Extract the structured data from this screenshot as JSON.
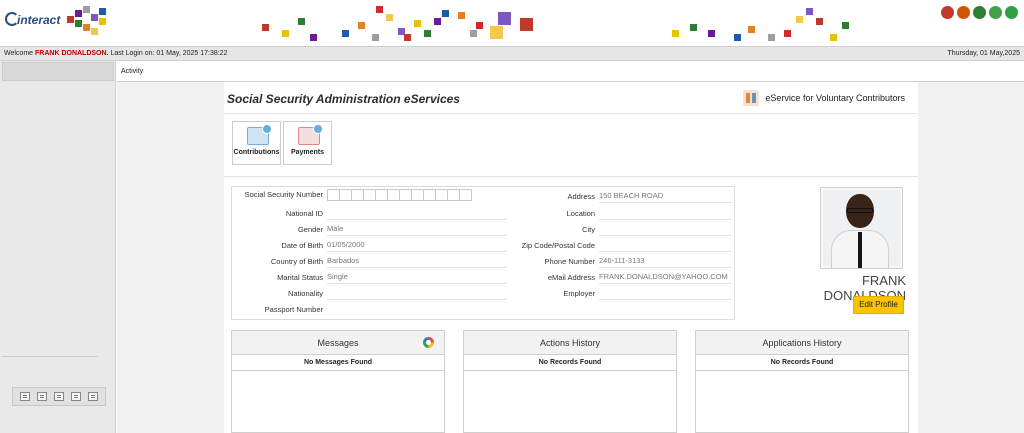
{
  "header": {
    "logo_text": "interact",
    "deco_colors": [
      "#c0392b",
      "#e6c200",
      "#2e7d32",
      "#6a1b9a",
      "#1e5aa8",
      "#e67e22",
      "#9e9e9e",
      "#d62828",
      "#f2c94c",
      "#7e57c2"
    ],
    "icons": [
      {
        "name": "home-icon",
        "color": "#c0392b"
      },
      {
        "name": "users-icon",
        "color": "#d35400"
      },
      {
        "name": "settings-icon",
        "color": "#2e7d32"
      },
      {
        "name": "help-icon",
        "color": "#43a047"
      },
      {
        "name": "power-icon",
        "color": "#2f9e44"
      }
    ]
  },
  "welcome": {
    "prefix": "Welcome",
    "user": "FRANK DONALDSON.",
    "last_login": "Last Login on: 01 May, 2025 17:38:22",
    "date": "Thursday, 01 May,2025"
  },
  "activity_label": "Activity",
  "page": {
    "title": "Social Security Administration eServices",
    "voluntary_link": "eService for Voluntary Contributors"
  },
  "tiles": [
    {
      "label": "Contributions"
    },
    {
      "label": "Payments"
    }
  ],
  "profile": {
    "left_fields": [
      {
        "label": "Social Security Number",
        "value": ""
      },
      {
        "label": "National ID",
        "value": ""
      },
      {
        "label": "Gender",
        "value": "Male"
      },
      {
        "label": "Date of Birth",
        "value": "01/05/2000"
      },
      {
        "label": "Country of Birth",
        "value": "Barbados"
      },
      {
        "label": "Marital Status",
        "value": "Single"
      },
      {
        "label": "Nationality",
        "value": ""
      },
      {
        "label": "Passport Number",
        "value": ""
      }
    ],
    "right_fields": [
      {
        "label": "Address",
        "value": "150 BEACH ROAD"
      },
      {
        "label": "Location",
        "value": ""
      },
      {
        "label": "City",
        "value": ""
      },
      {
        "label": "Zip Code/Postal Code",
        "value": ""
      },
      {
        "label": "Phone Number",
        "value": "246-111-3133"
      },
      {
        "label": "eMail Address",
        "value": "FRANK.DONALDSON@YAHOO.COM"
      },
      {
        "label": "Employer",
        "value": ""
      }
    ],
    "name": "FRANK DONALDSON",
    "edit_label": "Edit Profile"
  },
  "panels": [
    {
      "title": "Messages",
      "empty": "No Messages Found"
    },
    {
      "title": "Actions History",
      "empty": "No Records Found"
    },
    {
      "title": "Applications History",
      "empty": "No Records Found"
    }
  ]
}
